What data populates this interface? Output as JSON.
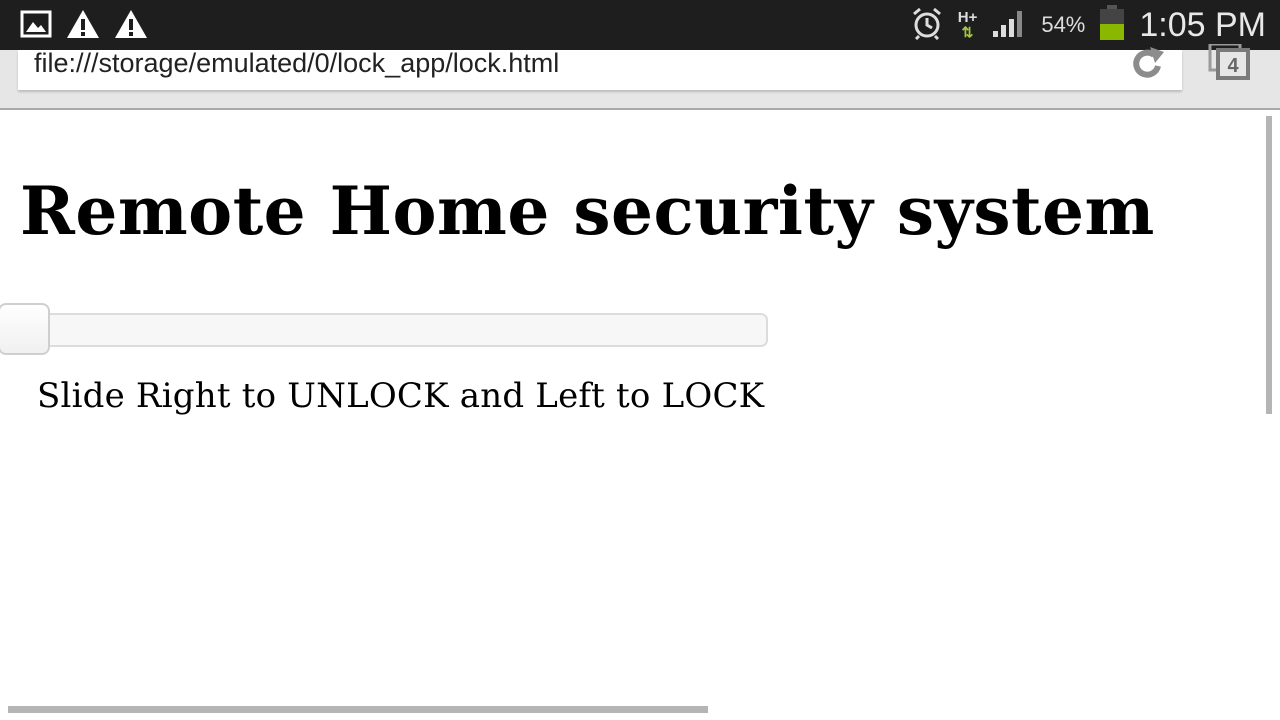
{
  "status_bar": {
    "left_icons": [
      "image-icon",
      "warning-icon",
      "warning-icon"
    ],
    "network_type": "H+",
    "battery_percent": "54%",
    "time": "1:05 PM",
    "colors": {
      "background": "#1e1e1e",
      "battery": "#8ab800",
      "data_arrows": "#a6c93a"
    }
  },
  "browser": {
    "url": "file:///storage/emulated/0/lock_app/lock.html",
    "tab_count": "4"
  },
  "page": {
    "title": "Remote Home security system",
    "slider": {
      "value_fraction": 0.0
    },
    "instruction": "Slide Right to UNLOCK and Left to LOCK"
  }
}
